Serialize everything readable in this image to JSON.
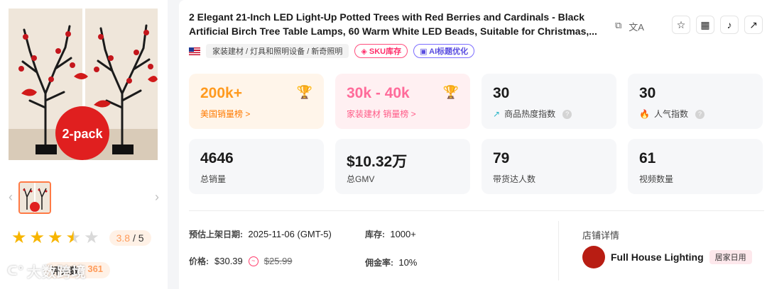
{
  "gallery": {
    "badge_text": "2-pack",
    "prev_arrow": "‹",
    "next_arrow": "›"
  },
  "rating": {
    "score": "3.8",
    "max": "/ 5",
    "stars_value": 3.5,
    "review_label": "评论数:",
    "review_count": "361"
  },
  "watermark": {
    "text": "大数跨境"
  },
  "product": {
    "title": "2 Elegant 21-Inch LED Light-Up Potted Trees with Red Berries and Cardinals - Black Artificial Birch Tree Table Lamps, 60 Warm White LED Beads, Suitable for Christmas,...",
    "copy_icon": "copy-icon",
    "translate_icon": "translate-icon"
  },
  "actions": {
    "favorite_icon": "star-icon",
    "qrcode_icon": "qrcode-icon",
    "tiktok_icon": "tiktok-icon",
    "open_icon": "external-link-icon"
  },
  "tags": {
    "category": "家装建材 / 灯具和照明设备 / 新奇照明",
    "sku": "SKU库存",
    "ai": "AI标题优化"
  },
  "stats": {
    "us_rank": {
      "value": "200k+",
      "label": "美国销量榜 >"
    },
    "cat_rank": {
      "value": "30k - 40k",
      "label": "家装建材 销量榜 >"
    },
    "heat": {
      "value": "30",
      "label": "商品热度指数"
    },
    "popularity": {
      "value": "30",
      "label": "人气指数"
    },
    "total_sales": {
      "value": "4646",
      "label": "总销量"
    },
    "gmv": {
      "value": "$10.32万",
      "label": "总GMV"
    },
    "influencers": {
      "value": "79",
      "label": "带货达人数"
    },
    "videos": {
      "value": "61",
      "label": "视频数量"
    }
  },
  "details": {
    "listed_label": "预估上架日期:",
    "listed_value": "2025-11-06 (GMT-5)",
    "stock_label": "库存:",
    "stock_value": "1000+",
    "price_label": "价格:",
    "price_value": "$30.39",
    "price_original": "$25.99",
    "commission_label": "佣金率:",
    "commission_value": "10%"
  },
  "shop": {
    "section_label": "店铺详情",
    "name": "Full House Lighting",
    "logo_text": "Full House Lighting",
    "category_tag": "居家日用"
  },
  "colors": {
    "accent_orange": "#ff9a1f",
    "accent_pink": "#ff6b9a",
    "star": "#f7b500"
  }
}
